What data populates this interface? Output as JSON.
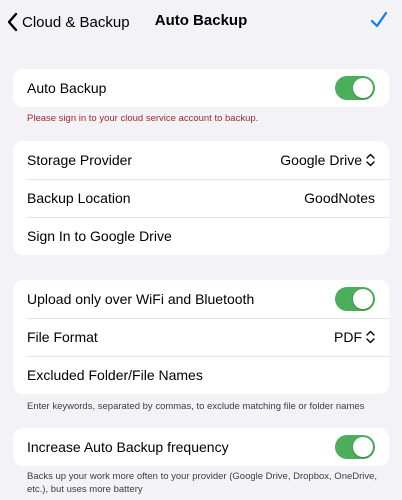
{
  "nav": {
    "back_label": "Cloud & Backup",
    "title": "Auto Backup"
  },
  "auto_backup": {
    "label": "Auto Backup",
    "enabled": true,
    "warning": "Please sign in to your cloud service account to backup."
  },
  "storage": {
    "provider_label": "Storage Provider",
    "provider_value": "Google Drive",
    "location_label": "Backup Location",
    "location_value": "GoodNotes",
    "sign_in_label": "Sign In to Google Drive"
  },
  "options": {
    "wifi_label": "Upload only over WiFi and Bluetooth",
    "wifi_enabled": true,
    "format_label": "File Format",
    "format_value": "PDF",
    "excluded_label": "Excluded Folder/File Names",
    "excluded_note": "Enter keywords, separated by commas, to exclude matching file or folder names"
  },
  "frequency": {
    "label": "Increase Auto Backup frequency",
    "enabled": true,
    "note": "Backs up your work more often to your provider (Google Drive, Dropbox, OneDrive, etc.), but uses more battery"
  },
  "colors": {
    "toggle_on": "#4cae5a",
    "accent": "#0a7aff",
    "warning": "#a42a2a",
    "background": "#f2f2f7"
  },
  "icons": [
    "chevron-left-icon",
    "checkmark-icon",
    "chevron-up-down-icon"
  ]
}
